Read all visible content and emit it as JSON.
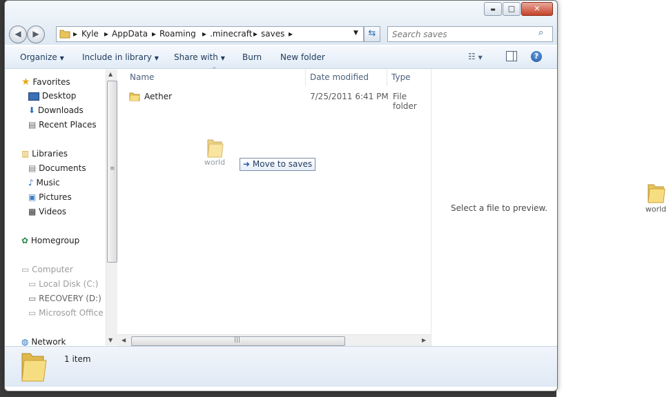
{
  "window": {
    "minimize": "▬",
    "maximize": "□",
    "close": "✕"
  },
  "address": {
    "crumbs": [
      "Kyle",
      "AppData",
      "Roaming",
      ".minecraft",
      "saves"
    ]
  },
  "search": {
    "placeholder": "Search saves"
  },
  "toolbar": {
    "organize": "Organize",
    "include": "Include in library",
    "share": "Share with",
    "burn": "Burn",
    "new_folder": "New folder"
  },
  "nav": {
    "favorites": "Favorites",
    "desktop": "Desktop",
    "downloads": "Downloads",
    "recent": "Recent Places",
    "libraries": "Libraries",
    "documents": "Documents",
    "music": "Music",
    "pictures": "Pictures",
    "videos": "Videos",
    "homegroup": "Homegroup",
    "computer": "Computer",
    "local_disk": "Local Disk (C:)",
    "recovery": "RECOVERY (D:)",
    "office": "Microsoft Office",
    "network": "Network"
  },
  "columns": {
    "name": "Name",
    "date": "Date modified",
    "type": "Type"
  },
  "files": [
    {
      "name": "Aether",
      "date": "7/25/2011 6:41 PM",
      "type": "File folder"
    }
  ],
  "drag": {
    "label": "world",
    "tooltip": "Move to saves"
  },
  "preview": {
    "text": "Select a file to preview."
  },
  "details": {
    "count": "1 item"
  },
  "desktop_icon": {
    "label": "world"
  }
}
